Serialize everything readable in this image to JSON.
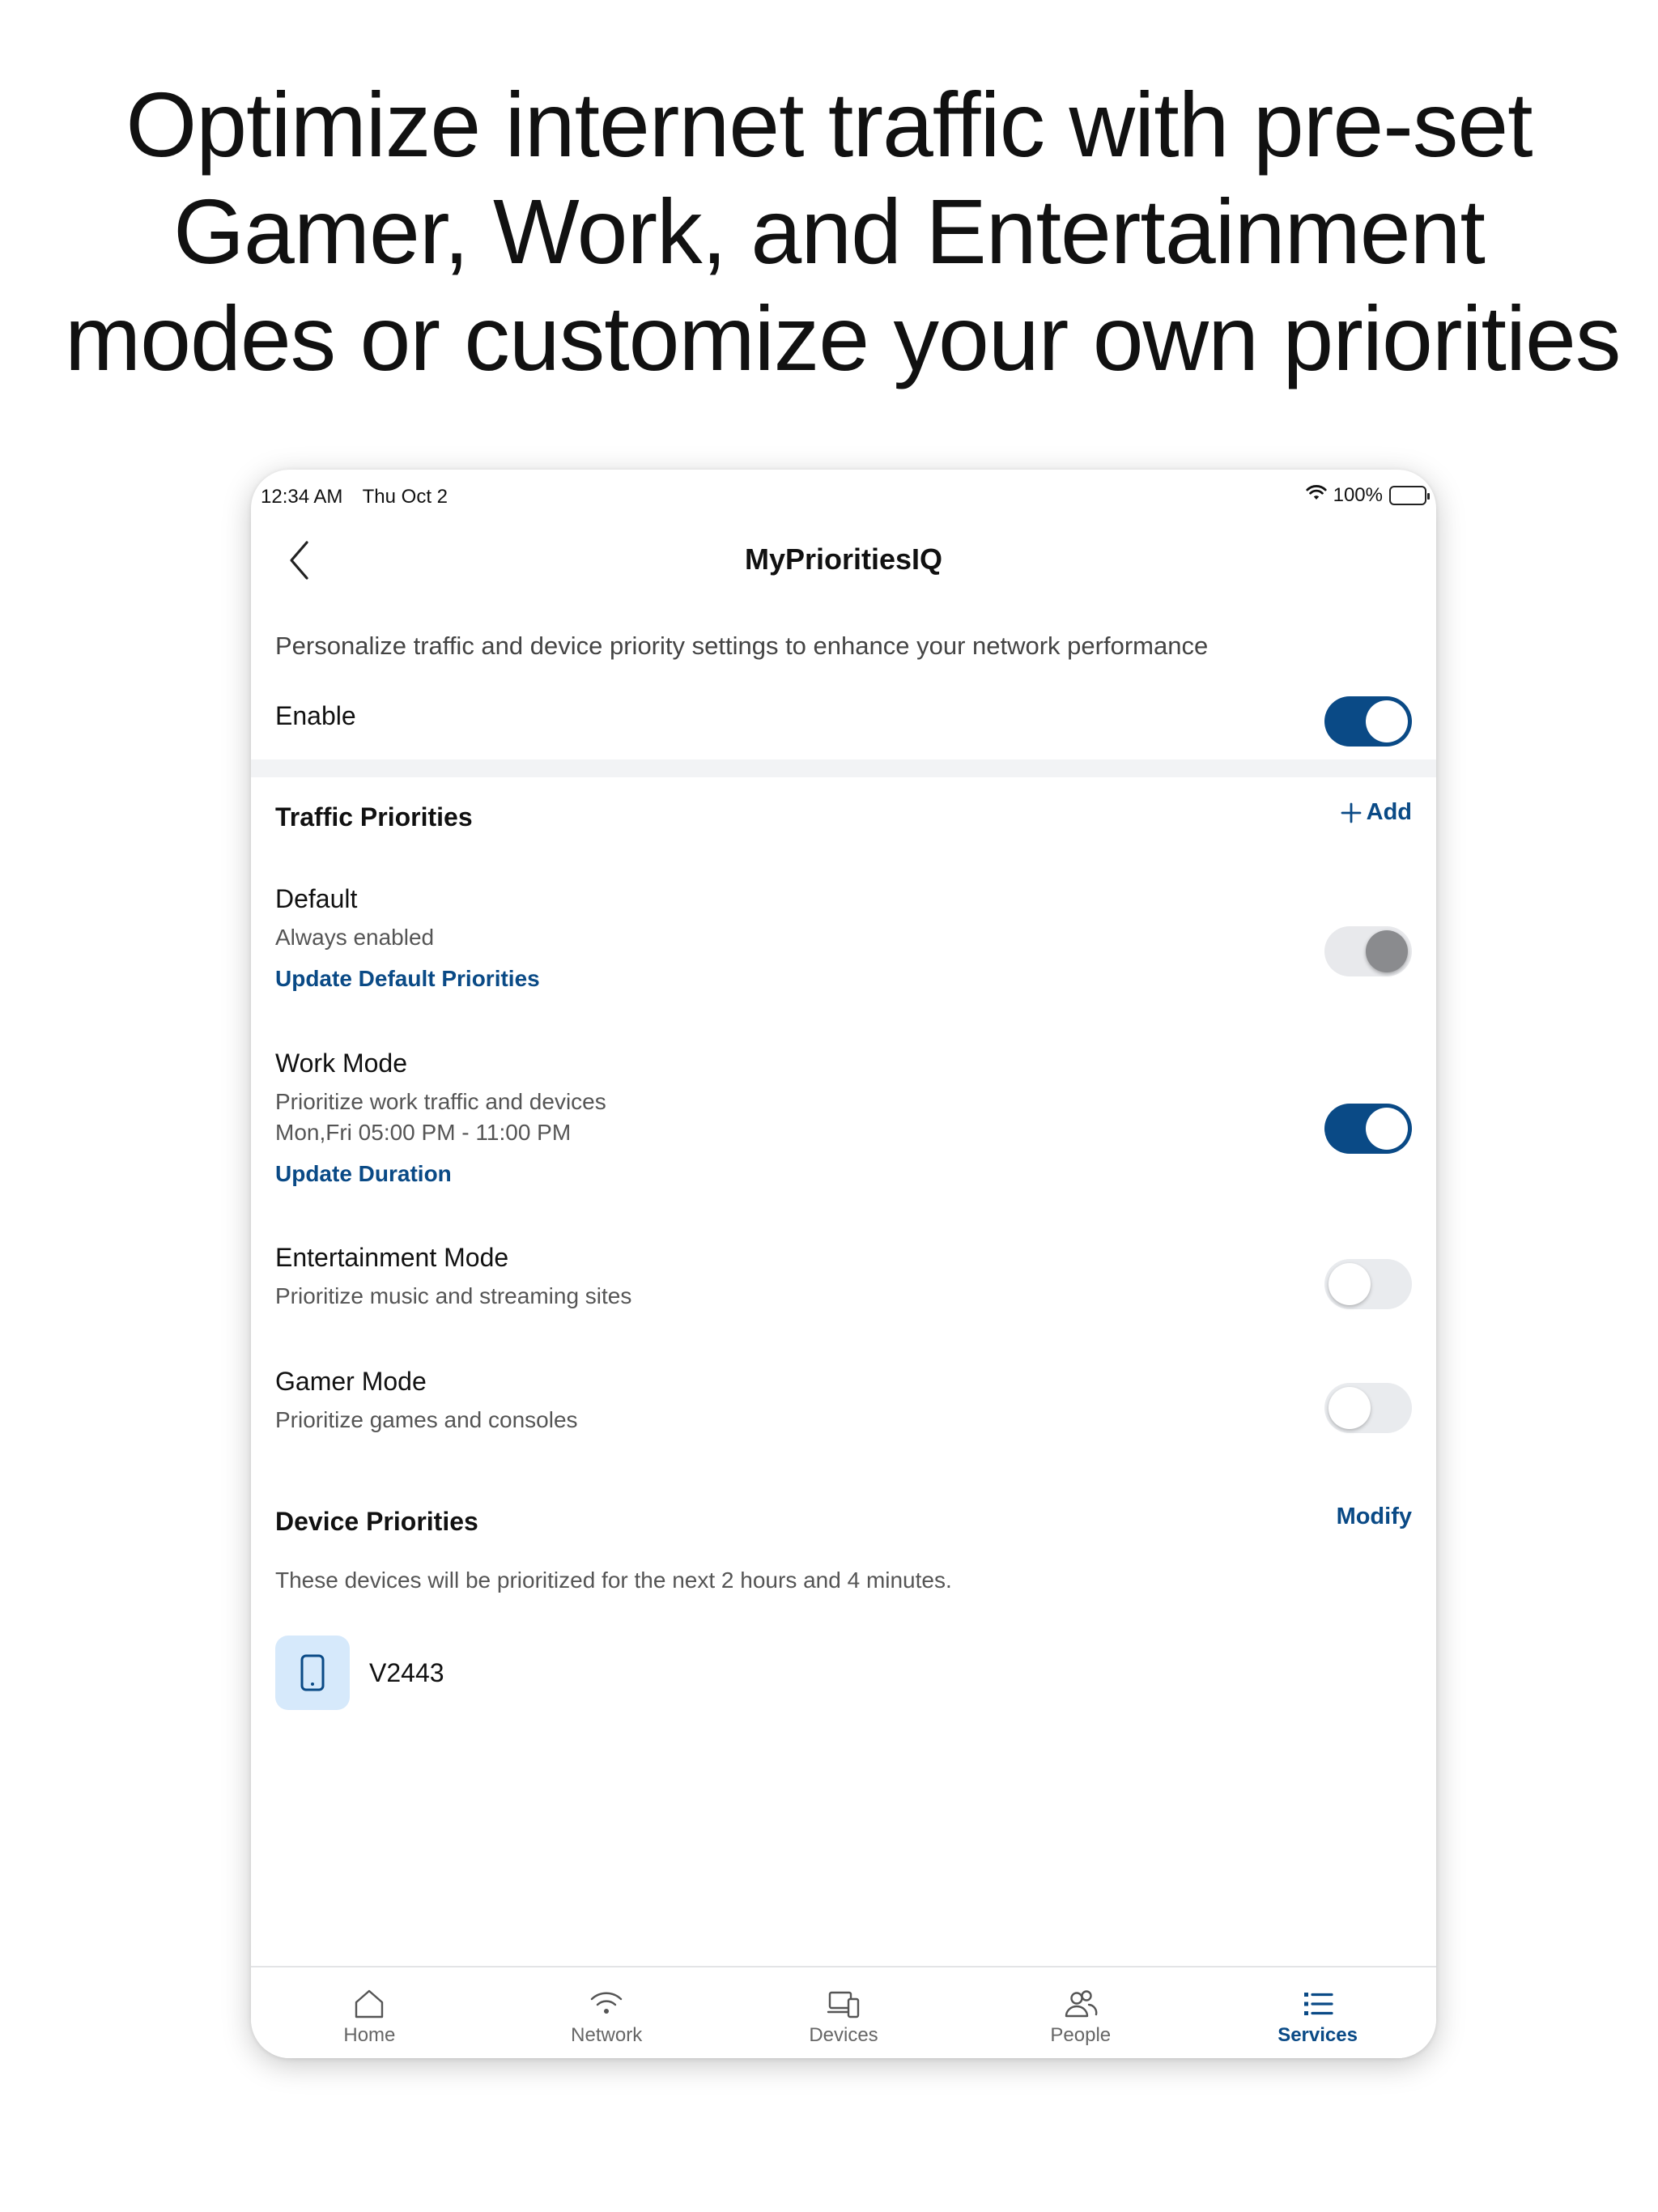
{
  "headline": {
    "line1": "Optimize internet traffic with pre-set",
    "line2": "Gamer, Work, and Entertainment",
    "line3": "modes or customize your own priorities"
  },
  "status_bar": {
    "time": "12:34 AM",
    "date": "Thu Oct 2",
    "battery": "100%"
  },
  "nav": {
    "title": "MyPrioritiesIQ",
    "back_icon": "chevron-left-icon"
  },
  "intro": "Personalize traffic and device priority settings to enhance your network performance",
  "enable": {
    "label": "Enable",
    "on": true
  },
  "traffic": {
    "title": "Traffic Priorities",
    "add_label": "Add",
    "modes": [
      {
        "name": "Default",
        "desc": "Always enabled",
        "link": "Update Default Priorities",
        "state": "disabled-on"
      },
      {
        "name": "Work Mode",
        "desc": "Prioritize work traffic and devices",
        "schedule": "Mon,Fri 05:00 PM - 11:00 PM",
        "link": "Update Duration",
        "state": "on"
      },
      {
        "name": "Entertainment Mode",
        "desc": "Prioritize music and streaming sites",
        "state": "off"
      },
      {
        "name": "Gamer Mode",
        "desc": "Prioritize games and consoles",
        "state": "off"
      }
    ]
  },
  "devices": {
    "title": "Device Priorities",
    "modify_label": "Modify",
    "note": "These devices will be prioritized for the next 2 hours and 4 minutes.",
    "items": [
      {
        "name": "V2443",
        "icon": "phone-icon"
      }
    ]
  },
  "tabs": [
    {
      "label": "Home",
      "icon": "home-icon"
    },
    {
      "label": "Network",
      "icon": "wifi-icon"
    },
    {
      "label": "Devices",
      "icon": "devices-icon"
    },
    {
      "label": "People",
      "icon": "people-icon"
    },
    {
      "label": "Services",
      "icon": "list-icon",
      "active": true
    }
  ],
  "colors": {
    "accent": "#0a4a86",
    "toggle_off": "#e9ebee",
    "device_icon_bg": "#d6e9fb"
  }
}
